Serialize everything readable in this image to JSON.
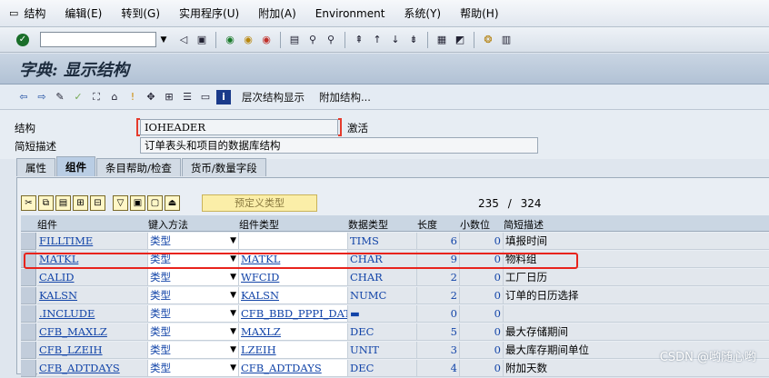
{
  "menu": [
    "结构",
    "编辑(E)",
    "转到(G)",
    "实用程序(U)",
    "附加(A)",
    "Environment",
    "系统(Y)",
    "帮助(H)"
  ],
  "toolbar": {
    "command_value": "",
    "icons": [
      "check-icon",
      "back-icon",
      "save-icon",
      "back-green-icon",
      "exit-icon",
      "cancel-icon",
      "print-icon",
      "find-icon",
      "find-next-icon",
      "first-page-icon",
      "prev-page-icon",
      "next-page-icon",
      "last-page-icon",
      "new-session-icon",
      "shortcut-icon",
      "help-icon",
      "layout-icon"
    ]
  },
  "title": "字典: 显示结构",
  "app_toolbar": {
    "hierarchy": "层次结构显示",
    "append": "附加结构..."
  },
  "form": {
    "struct_label": "结构",
    "struct_value": "IOHEADER",
    "struct_status": "激活",
    "desc_label": "简短描述",
    "desc_value": "订单表头和项目的数据库结构"
  },
  "tabs": [
    "属性",
    "组件",
    "条目帮助/检查",
    "货币/数量字段"
  ],
  "active_tab": "组件",
  "table_tools": {
    "predefined": "预定义类型"
  },
  "counter": {
    "current": "235",
    "separator": "/",
    "total": "324"
  },
  "columns": [
    "组件",
    "键入方法",
    "组件类型",
    "数据类型",
    "长度",
    "小数位",
    "简短描述"
  ],
  "rows": [
    {
      "component": "FILLTIME",
      "method": "类型",
      "comp_type": "",
      "data_type": "TIMS",
      "length": "6",
      "decimals": "0",
      "desc": "填报时间"
    },
    {
      "component": "MATKL",
      "method": "类型",
      "comp_type": "MATKL",
      "data_type": "CHAR",
      "length": "9",
      "decimals": "0",
      "desc": "物料组"
    },
    {
      "component": "CALID",
      "method": "类型",
      "comp_type": "WFCID",
      "data_type": "CHAR",
      "length": "2",
      "decimals": "0",
      "desc": "工厂日历"
    },
    {
      "component": "KALSN",
      "method": "类型",
      "comp_type": "KALSN",
      "data_type": "NUMC",
      "length": "2",
      "decimals": "0",
      "desc": "订单的日历选择"
    },
    {
      "component": ".INCLUDE",
      "method": "类型",
      "comp_type": "CFB_BBD_PPPI_DAT",
      "data_type": "▬",
      "length": "0",
      "decimals": "0",
      "desc": ""
    },
    {
      "component": "CFB_MAXLZ",
      "method": "类型",
      "comp_type": "MAXLZ",
      "data_type": "DEC",
      "length": "5",
      "decimals": "0",
      "desc": "最大存储期间"
    },
    {
      "component": "CFB_LZEIH",
      "method": "类型",
      "comp_type": "LZEIH",
      "data_type": "UNIT",
      "length": "3",
      "decimals": "0",
      "desc": "最大库存期间单位"
    },
    {
      "component": "CFB_ADTDAYS",
      "method": "类型",
      "comp_type": "CFB_ADTDAYS",
      "data_type": "DEC",
      "length": "4",
      "decimals": "0",
      "desc": "附加天数"
    }
  ],
  "watermark": "CSDN @哟随心哟"
}
